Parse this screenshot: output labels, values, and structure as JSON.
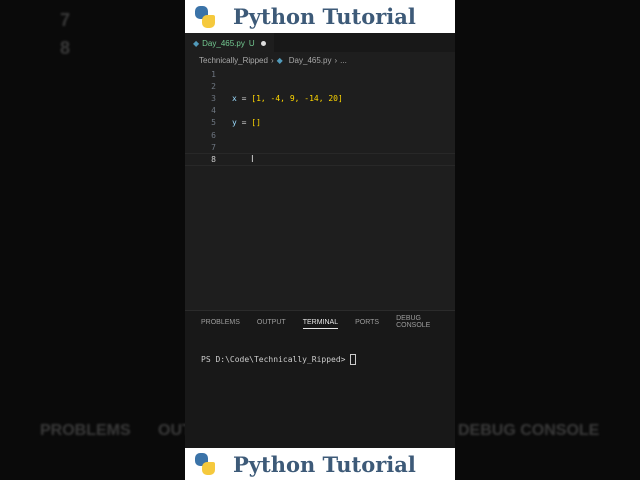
{
  "banner": {
    "title": "Python Tutorial"
  },
  "background": {
    "line7": "7",
    "line8": "8",
    "problems": "PROBLEMS",
    "output": "OUT",
    "debug": "DEBUG CONSOLE"
  },
  "editor": {
    "tab": {
      "filename": "Day_465.py",
      "status": "U"
    },
    "breadcrumb": {
      "folder": "Technically_Ripped",
      "file": "Day_465.py",
      "more": "..."
    },
    "lines": [
      {
        "n": "1",
        "code": ""
      },
      {
        "n": "2",
        "code": ""
      },
      {
        "n": "3",
        "var": "x",
        "op": " = ",
        "val": "[1, -4, 9, -14, 20]"
      },
      {
        "n": "4",
        "code": ""
      },
      {
        "n": "5",
        "var": "y",
        "op": " = ",
        "val": "[]"
      },
      {
        "n": "6",
        "code": ""
      },
      {
        "n": "7",
        "code": ""
      },
      {
        "n": "8",
        "code": ""
      }
    ]
  },
  "panel": {
    "tabs": [
      "PROBLEMS",
      "OUTPUT",
      "TERMINAL",
      "PORTS",
      "DEBUG CONSOLE"
    ],
    "active": "TERMINAL",
    "prompt": "PS D:\\Code\\Technically_Ripped>"
  }
}
